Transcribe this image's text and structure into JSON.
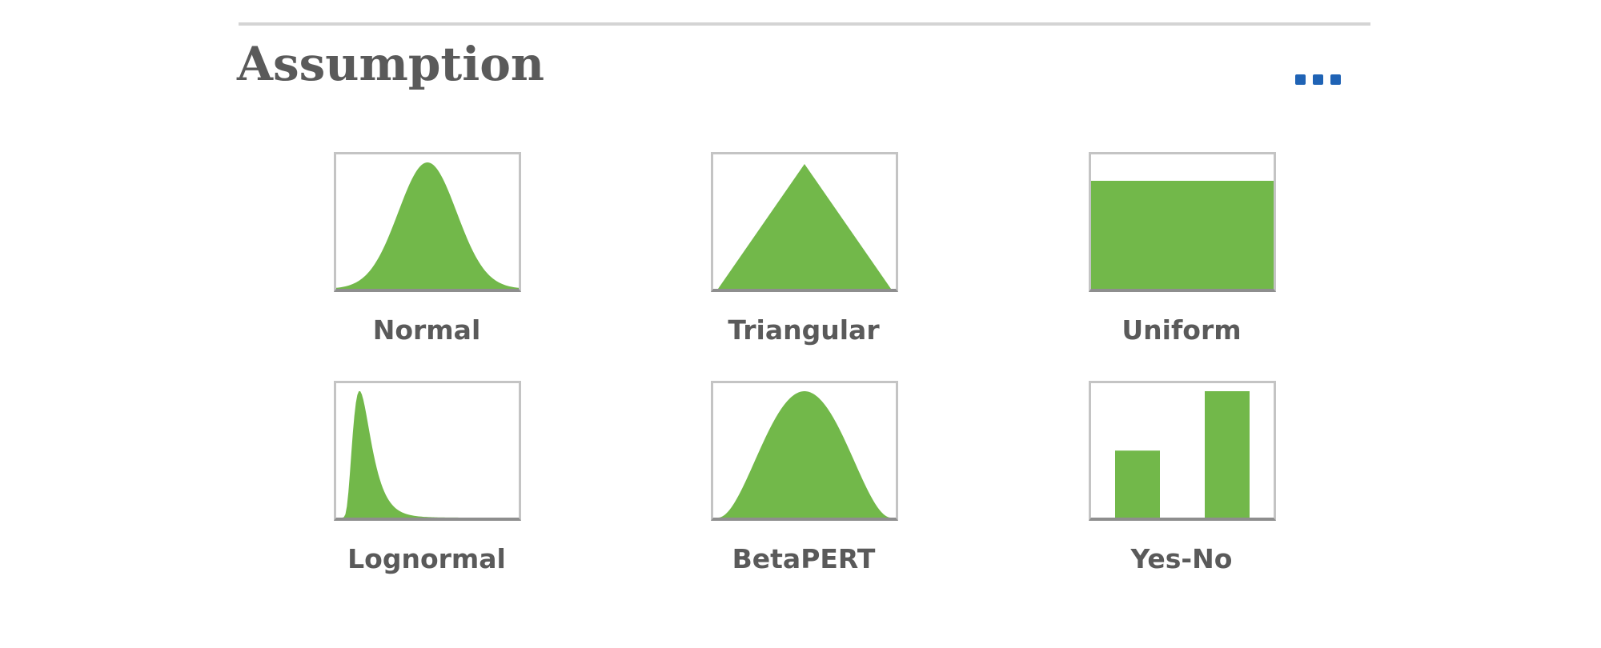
{
  "panel": {
    "title": "Assumption",
    "more_button": {
      "label": "More options",
      "icon": "ellipsis-icon"
    }
  },
  "colors": {
    "fill": "#72b84a",
    "title_text": "#5a5a5a",
    "accent": "#1f63b5",
    "border": "#c4c4c4"
  },
  "distributions": [
    {
      "id": "normal",
      "label": "Normal",
      "icon": "normal-distribution-icon"
    },
    {
      "id": "triangular",
      "label": "Triangular",
      "icon": "triangular-distribution-icon"
    },
    {
      "id": "uniform",
      "label": "Uniform",
      "icon": "uniform-distribution-icon"
    },
    {
      "id": "lognormal",
      "label": "Lognormal",
      "icon": "lognormal-distribution-icon"
    },
    {
      "id": "betapert",
      "label": "BetaPERT",
      "icon": "betapert-distribution-icon"
    },
    {
      "id": "yesno",
      "label": "Yes-No",
      "icon": "yes-no-distribution-icon",
      "bar_values": [
        0.53,
        1.0
      ]
    }
  ]
}
